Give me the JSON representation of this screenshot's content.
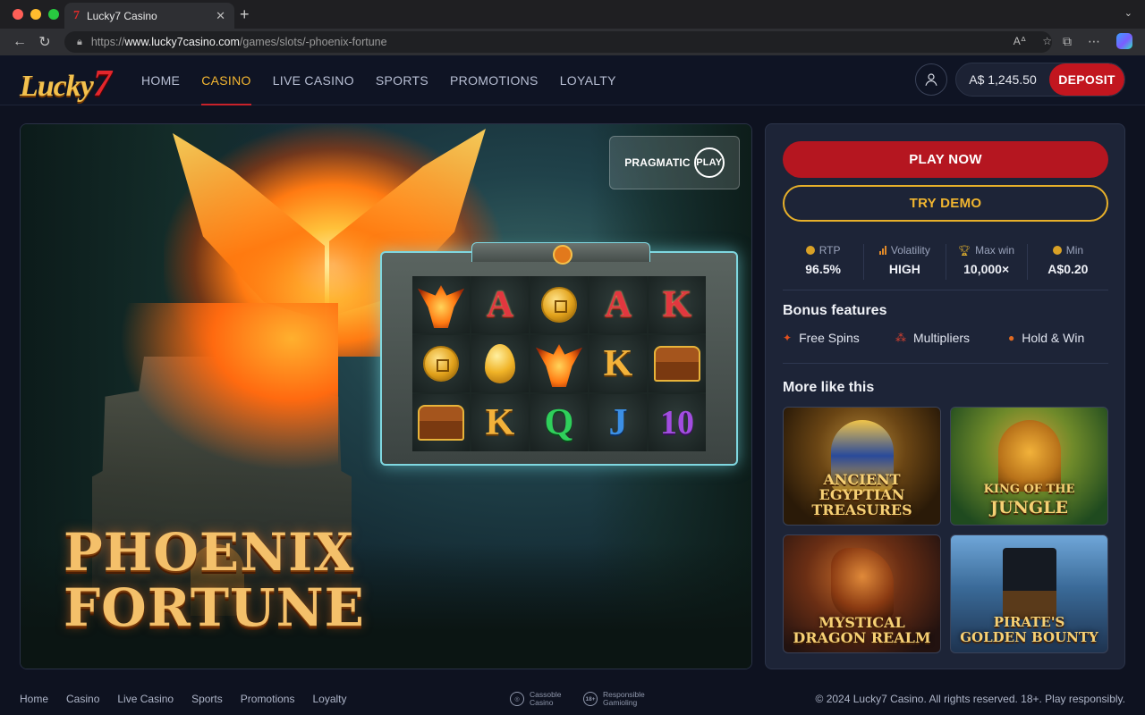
{
  "browser": {
    "tab_title": "Lucky7 Casino",
    "tab_favicon": "7",
    "close_tab": "✕",
    "new_tab": "+",
    "url_proto": "https://",
    "url_host": "www.lucky7casino.com",
    "url_path": "/games/slots/-phoenix-fortune",
    "traffic_colors": [
      "#ff5f57",
      "#febc2e",
      "#28c840"
    ]
  },
  "header": {
    "logo_text": "Lucky",
    "logo_seven": "7",
    "nav": [
      {
        "label": "HOME",
        "active": false
      },
      {
        "label": "CASINO",
        "active": true
      },
      {
        "label": "LIVE CASINO",
        "active": false
      },
      {
        "label": "SPORTS",
        "active": false
      },
      {
        "label": "PROMOTIONS",
        "active": false
      },
      {
        "label": "LOYALTY",
        "active": false
      }
    ],
    "balance": "A$ 1,245.50",
    "deposit_label": "DEPOSIT"
  },
  "hero": {
    "provider_name": "PRAGMATIC",
    "provider_ring": "PLAY",
    "title_line1": "PHOENIX",
    "title_line2": "FORTUNE",
    "reels": [
      [
        "phoenix",
        "A",
        "coin",
        "A",
        "K"
      ],
      [
        "coin",
        "egg",
        "phoenix",
        "K",
        "chest"
      ],
      [
        "chest",
        "K",
        "Q",
        "J",
        "10"
      ]
    ]
  },
  "panel": {
    "play_label": "PLAY NOW",
    "demo_label": "TRY DEMO",
    "stats": [
      {
        "label": "RTP",
        "value": "96.5%",
        "icon": "rtp-icon"
      },
      {
        "label": "Volatility",
        "value": "HIGH",
        "icon": "volatility-icon"
      },
      {
        "label": "Max win",
        "value": "10,000×",
        "icon": "trophy-icon"
      },
      {
        "label": "Min",
        "value": "A$0.20",
        "icon": "coin-icon"
      }
    ],
    "bonus_title": "Bonus features",
    "features": [
      {
        "label": "Free Spins",
        "icon": "free-spins-icon"
      },
      {
        "label": "Multipliers",
        "icon": "multipliers-icon"
      },
      {
        "label": "Hold & Win",
        "icon": "hold-win-icon"
      }
    ],
    "more_title": "More like this",
    "games": [
      {
        "line1": "ANCIENT",
        "line2": "EGYPTIAN",
        "line3": "TREASURES"
      },
      {
        "line1": "KING OF THE",
        "line2": "JUNGLE",
        "line3": ""
      },
      {
        "line1": "MYSTICAL",
        "line2": "DRAGON REALM",
        "line3": ""
      },
      {
        "line1": "PIRATE'S",
        "line2": "GOLDEN BOUNTY",
        "line3": ""
      }
    ]
  },
  "footer": {
    "links": [
      "Home",
      "Casino",
      "Live Casino",
      "Sports",
      "Promotions",
      "Loyalty"
    ],
    "badge1": "Cassoble Casino",
    "badge2_icon": "18+",
    "badge2": "Responsible Gamioling",
    "copyright": "© 2024 Lucky7 Casino. All rights reserved. 18+. Play responsibly."
  },
  "colors": {
    "accent_gold": "#f5b731",
    "deposit_red": "#c2161f",
    "play_red": "#b51620",
    "demo_gold": "#e7b02a"
  }
}
